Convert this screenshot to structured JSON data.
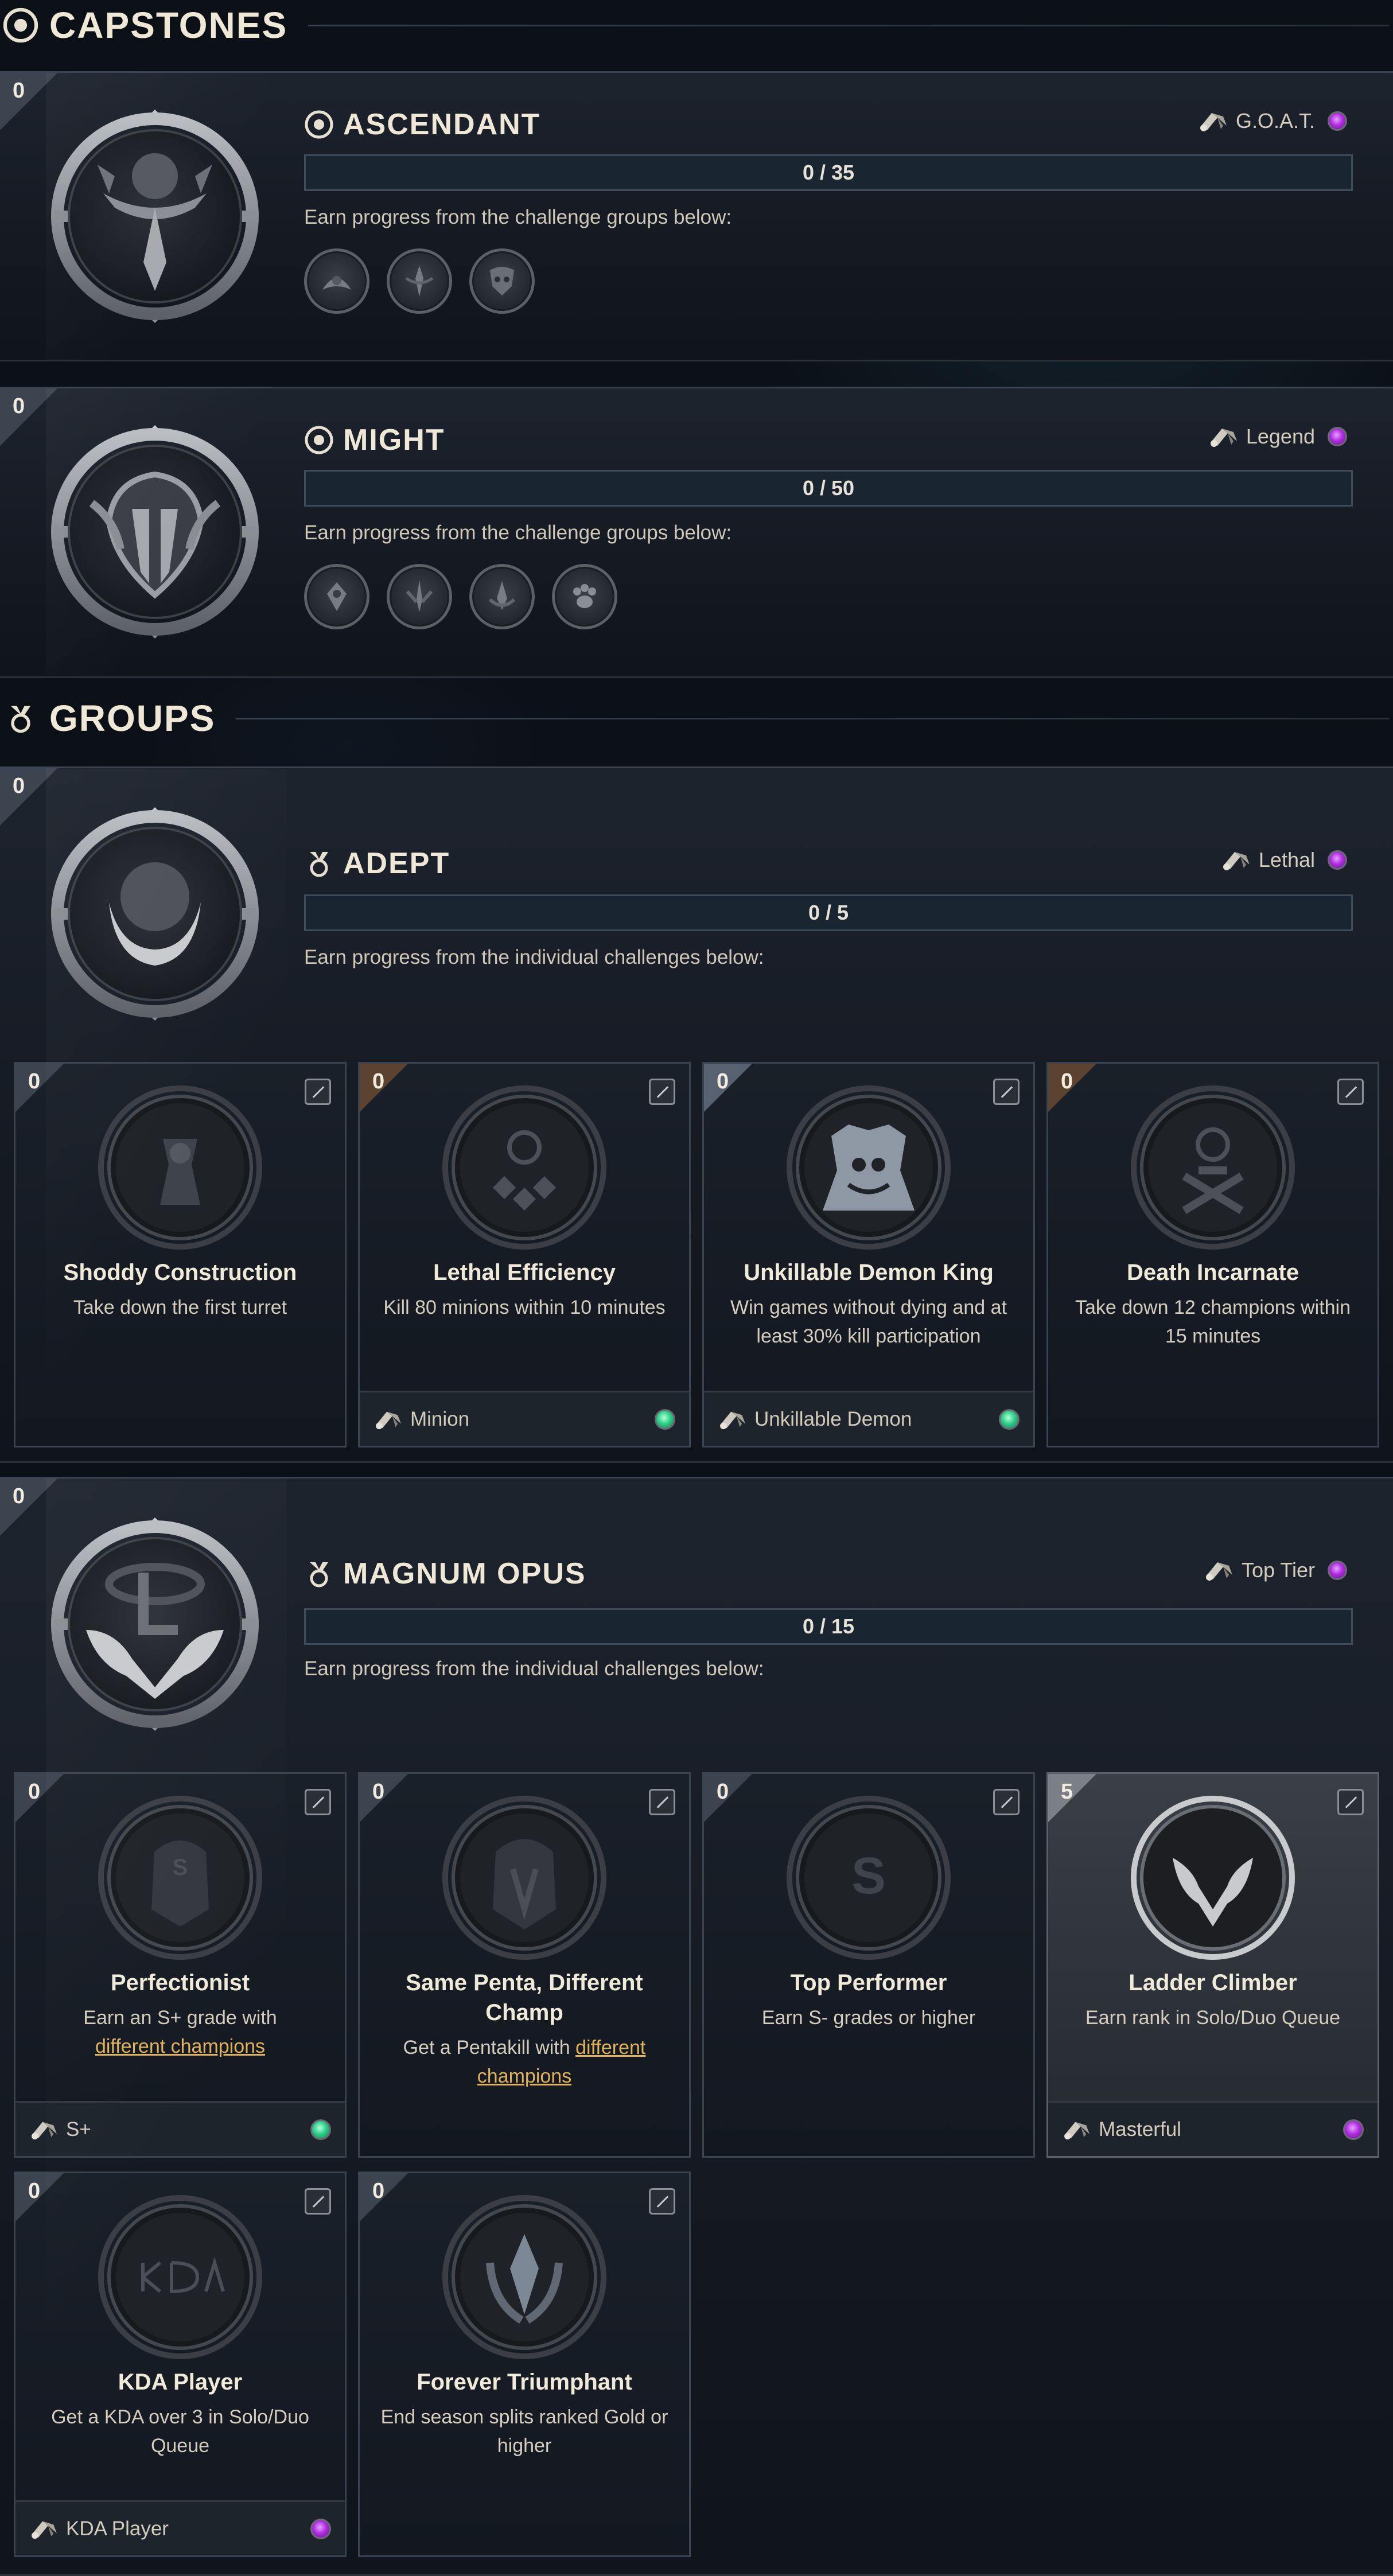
{
  "capstones_header": {
    "title": "CAPSTONES"
  },
  "groups_header": {
    "title": "GROUPS"
  },
  "capstones": [
    {
      "count": "0",
      "title": "ASCENDANT",
      "reward": "G.O.A.T.",
      "reward_color": "purple",
      "progress": "0 / 35",
      "hint": "Earn progress from the challenge groups below:",
      "groups": [
        "group-icon-1",
        "group-icon-2",
        "group-icon-3"
      ]
    },
    {
      "count": "0",
      "title": "MIGHT",
      "reward": "Legend",
      "reward_color": "purple",
      "progress": "0 / 50",
      "hint": "Earn progress from the challenge groups below:",
      "groups": [
        "group-icon-1",
        "group-icon-2",
        "group-icon-3",
        "group-icon-4"
      ]
    }
  ],
  "groups": [
    {
      "count": "0",
      "title": "ADEPT",
      "reward": "Lethal",
      "progress": "0 / 5",
      "hint": "Earn progress from the individual challenges below:",
      "cards": [
        {
          "count": "0",
          "title": "Shoddy Construction",
          "desc": "Take down the first turret",
          "tier": "none",
          "footer": ""
        },
        {
          "count": "0",
          "title": "Lethal Efficiency",
          "desc": "Kill 80 minions within 10 minutes",
          "tier": "bronze",
          "footer": "Minion",
          "footer_dot": "green"
        },
        {
          "count": "0",
          "title": "Unkillable Demon King",
          "desc": "Win games without dying and at least 30% kill participation",
          "tier": "silver",
          "footer": "Unkillable Demon",
          "footer_dot": "green"
        },
        {
          "count": "0",
          "title": "Death Incarnate",
          "desc": "Take down 12 champions within 15 minutes",
          "tier": "bronze",
          "footer": ""
        }
      ]
    },
    {
      "count": "0",
      "title": "MAGNUM OPUS",
      "reward": "Top Tier",
      "progress": "0 / 15",
      "hint": "Earn progress from the individual challenges below:",
      "cards": [
        {
          "count": "0",
          "title": "Perfectionist",
          "desc_pre": "Earn an S+ grade with",
          "desc_link": "different champions",
          "footer": "S+",
          "footer_dot": "green"
        },
        {
          "count": "0",
          "title_line1": "Same Penta, Different",
          "title_line2": "Champ",
          "desc_pre": "Get a Pentakill with",
          "desc_link": "different champions",
          "footer": ""
        },
        {
          "count": "0",
          "title": "Top Performer",
          "desc": "Earn S- grades or higher",
          "footer": ""
        },
        {
          "count": "5",
          "title": "Ladder Climber",
          "desc": "Earn rank in Solo/Duo Queue",
          "footer": "Masterful",
          "footer_dot": "purple"
        },
        {
          "count": "0",
          "title": "KDA Player",
          "desc": "Get a KDA over 3 in Solo/Duo Queue",
          "footer": "KDA Player",
          "footer_dot": "purple"
        },
        {
          "count": "0",
          "title": "Forever Triumphant",
          "desc": "End season splits ranked Gold or higher",
          "footer": ""
        }
      ]
    }
  ]
}
